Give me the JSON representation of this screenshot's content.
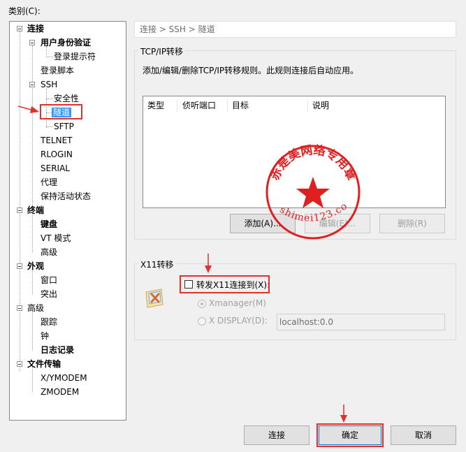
{
  "category_label": "类别(C):",
  "tree": {
    "connection": "连接",
    "user_auth": "用户身份验证",
    "login_prompt": "登录提示符",
    "login_script": "登录脚本",
    "ssh": "SSH",
    "security": "安全性",
    "tunnel": "隧道",
    "sftp": "SFTP",
    "telnet": "TELNET",
    "rlogin": "RLOGIN",
    "serial": "SERIAL",
    "proxy": "代理",
    "keepalive": "保持活动状态",
    "terminal": "终端",
    "keyboard": "键盘",
    "vt_mode": "VT 模式",
    "advanced": "高级",
    "appearance": "外观",
    "window": "窗口",
    "highlight": "突出",
    "advanced2": "高级",
    "trace": "跟踪",
    "bell": "钟",
    "logging": "日志记录",
    "file_transfer": "文件传输",
    "xymodem": "X/YMODEM",
    "zmodem": "ZMODEM"
  },
  "breadcrumb": "连接 > SSH > 隧道",
  "tcpip": {
    "title": "TCP/IP转移",
    "description": "添加/编辑/删除TCP/IP转移规则。此规则连接后自动应用。",
    "columns": [
      "类型",
      "侦听端口",
      "目标",
      "说明"
    ],
    "add_label": "添加(A)...",
    "edit_label": "编辑(E)...",
    "delete_label": "删除(R)"
  },
  "x11": {
    "title": "X11转移",
    "forward_label": "转发X11连接到(X):",
    "xmanager_label": "Xmanager(M)",
    "xdisplay_label": "X DISPLAY(D):",
    "xdisplay_value": "localhost:0.0"
  },
  "stamp": {
    "ring_text": "赤是美网络专用章",
    "url_text": "yishimei123.com"
  },
  "footer": {
    "connect_label": "连接",
    "ok_label": "确定",
    "cancel_label": "取消"
  },
  "colors": {
    "annotation_red": "#e03030",
    "selection_blue": "#3399ff",
    "stamp_red": "#e02020"
  }
}
